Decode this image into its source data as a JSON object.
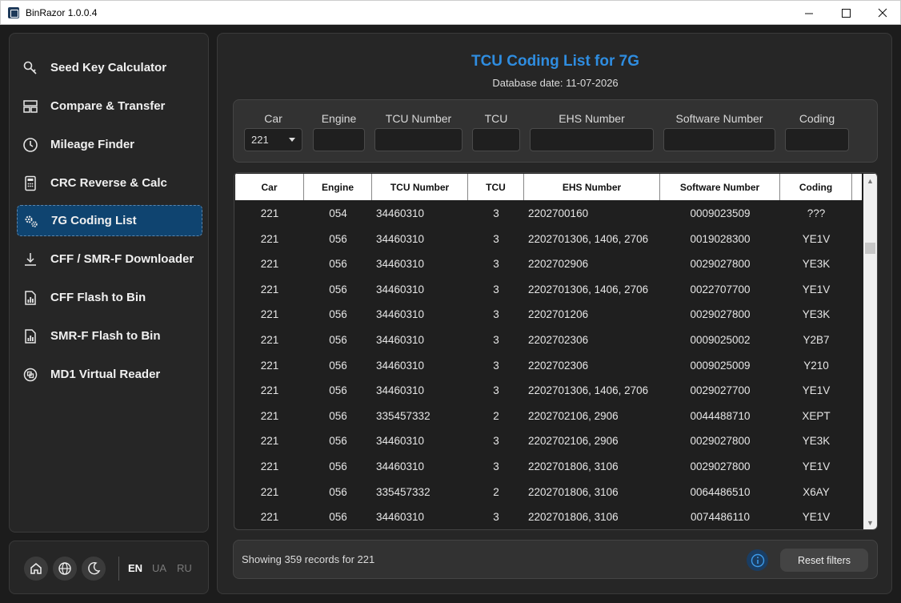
{
  "window": {
    "title": "BinRazor 1.0.0.4",
    "min": "─",
    "max": "☐",
    "close": "✕"
  },
  "sidebar": {
    "items": [
      {
        "label": "Seed Key Calculator",
        "icon": "key-icon"
      },
      {
        "label": "Compare & Transfer",
        "icon": "compare-icon"
      },
      {
        "label": "Mileage Finder",
        "icon": "clock-icon"
      },
      {
        "label": "CRC Reverse & Calc",
        "icon": "calculator-icon"
      },
      {
        "label": "7G Coding List",
        "icon": "gears-icon",
        "active": true
      },
      {
        "label": "CFF / SMR-F Downloader",
        "icon": "download-icon"
      },
      {
        "label": "CFF Flash to Bin",
        "icon": "file-chart-icon"
      },
      {
        "label": "SMR-F Flash to Bin",
        "icon": "file-chart-icon"
      },
      {
        "label": "MD1 Virtual Reader",
        "icon": "chip-icon"
      }
    ]
  },
  "bottom": {
    "languages": [
      "EN",
      "UA",
      "RU"
    ],
    "active_language": "EN"
  },
  "main": {
    "title": "TCU Coding List for 7G",
    "db_date": "Database date: 11-07-2026",
    "filters": {
      "labels": [
        "Car",
        "Engine",
        "TCU Number",
        "TCU",
        "EHS Number",
        "Software Number",
        "Coding"
      ],
      "car_value": "221"
    },
    "table": {
      "headers": [
        "Car",
        "Engine",
        "TCU Number",
        "TCU",
        "EHS Number",
        "Software Number",
        "Coding"
      ],
      "rows": [
        [
          "221",
          "054",
          "34460310",
          "3",
          "2202700160",
          "0009023509",
          "???"
        ],
        [
          "221",
          "056",
          "34460310",
          "3",
          "2202701306, 1406, 2706",
          "0019028300",
          "YE1V"
        ],
        [
          "221",
          "056",
          "34460310",
          "3",
          "2202702906",
          "0029027800",
          "YE3K"
        ],
        [
          "221",
          "056",
          "34460310",
          "3",
          "2202701306, 1406, 2706",
          "0022707700",
          "YE1V"
        ],
        [
          "221",
          "056",
          "34460310",
          "3",
          "2202701206",
          "0029027800",
          "YE3K"
        ],
        [
          "221",
          "056",
          "34460310",
          "3",
          "2202702306",
          "0009025002",
          "Y2B7"
        ],
        [
          "221",
          "056",
          "34460310",
          "3",
          "2202702306",
          "0009025009",
          "Y210"
        ],
        [
          "221",
          "056",
          "34460310",
          "3",
          "2202701306, 1406, 2706",
          "0029027700",
          "YE1V"
        ],
        [
          "221",
          "056",
          "335457332",
          "2",
          "2202702106, 2906",
          "0044488710",
          "XEPT"
        ],
        [
          "221",
          "056",
          "34460310",
          "3",
          "2202702106, 2906",
          "0029027800",
          "YE3K"
        ],
        [
          "221",
          "056",
          "34460310",
          "3",
          "2202701806, 3106",
          "0029027800",
          "YE1V"
        ],
        [
          "221",
          "056",
          "335457332",
          "2",
          "2202701806, 3106",
          "0064486510",
          "X6AY"
        ],
        [
          "221",
          "056",
          "34460310",
          "3",
          "2202701806, 3106",
          "0074486110",
          "YE1V"
        ]
      ]
    },
    "status": {
      "text": "Showing 359 records for 221",
      "reset_label": "Reset filters"
    }
  }
}
